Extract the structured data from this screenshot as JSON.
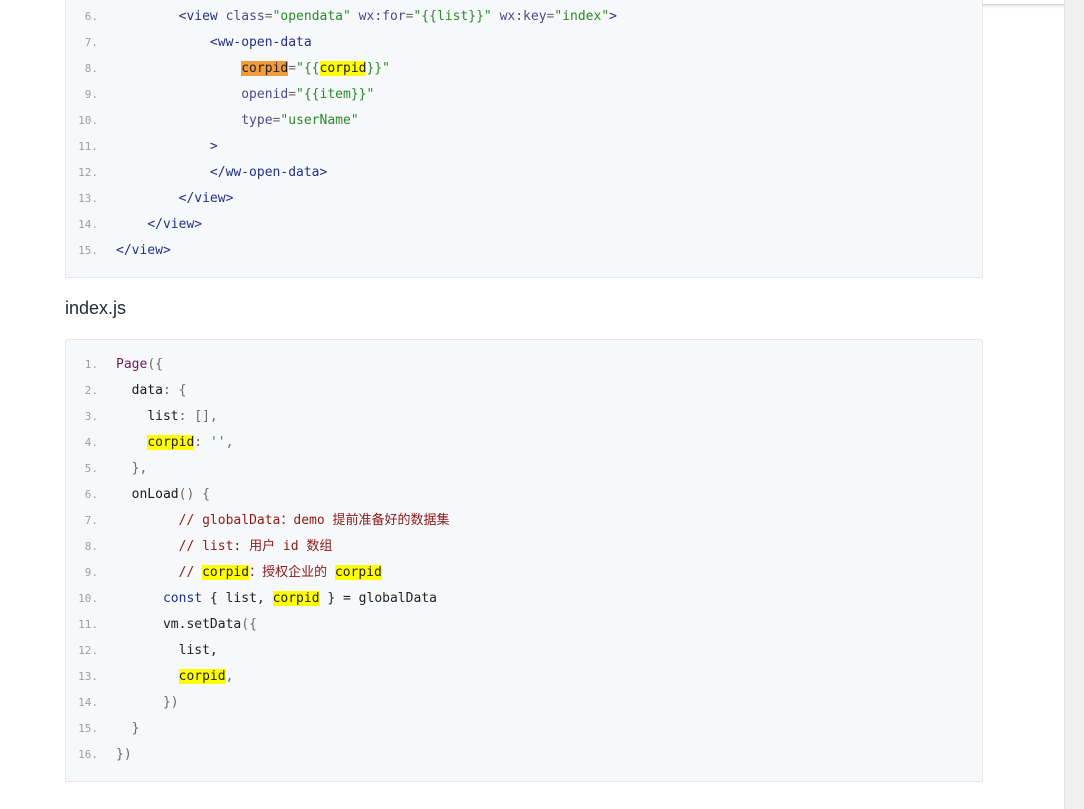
{
  "wxml_block": {
    "lines": [
      {
        "n": "6.",
        "tokens": [
          {
            "t": "        ",
            "c": "t-plain"
          },
          {
            "t": "<view ",
            "c": "t-tag"
          },
          {
            "t": "class",
            "c": "t-attr"
          },
          {
            "t": "=",
            "c": "t-punc"
          },
          {
            "t": "\"opendata\"",
            "c": "t-str"
          },
          {
            "t": " ",
            "c": "t-plain"
          },
          {
            "t": "wx:for",
            "c": "t-attr"
          },
          {
            "t": "=",
            "c": "t-punc"
          },
          {
            "t": "\"{{list}}\"",
            "c": "t-str"
          },
          {
            "t": " ",
            "c": "t-plain"
          },
          {
            "t": "wx:key",
            "c": "t-attr"
          },
          {
            "t": "=",
            "c": "t-punc"
          },
          {
            "t": "\"index\"",
            "c": "t-str"
          },
          {
            "t": ">",
            "c": "t-tag"
          }
        ]
      },
      {
        "n": "7.",
        "tokens": [
          {
            "t": "            ",
            "c": "t-plain"
          },
          {
            "t": "<ww-open-data",
            "c": "t-tag"
          }
        ]
      },
      {
        "n": "8.",
        "tokens": [
          {
            "t": "                ",
            "c": "t-plain"
          },
          {
            "t": "corpid",
            "c": "hl-cur"
          },
          {
            "t": "=",
            "c": "t-punc"
          },
          {
            "t": "\"{{",
            "c": "t-str"
          },
          {
            "t": "corpid",
            "c": "hl"
          },
          {
            "t": "}}\"",
            "c": "t-str"
          }
        ]
      },
      {
        "n": "9.",
        "tokens": [
          {
            "t": "                ",
            "c": "t-plain"
          },
          {
            "t": "openid",
            "c": "t-attr"
          },
          {
            "t": "=",
            "c": "t-punc"
          },
          {
            "t": "\"{{item}}\"",
            "c": "t-str"
          }
        ]
      },
      {
        "n": "10.",
        "tokens": [
          {
            "t": "                ",
            "c": "t-plain"
          },
          {
            "t": "type",
            "c": "t-attr"
          },
          {
            "t": "=",
            "c": "t-punc"
          },
          {
            "t": "\"userName\"",
            "c": "t-str"
          }
        ]
      },
      {
        "n": "11.",
        "tokens": [
          {
            "t": "            ",
            "c": "t-plain"
          },
          {
            "t": ">",
            "c": "t-tag"
          }
        ]
      },
      {
        "n": "12.",
        "tokens": [
          {
            "t": "            ",
            "c": "t-plain"
          },
          {
            "t": "</ww-open-data>",
            "c": "t-tag"
          }
        ]
      },
      {
        "n": "13.",
        "tokens": [
          {
            "t": "        ",
            "c": "t-plain"
          },
          {
            "t": "</view>",
            "c": "t-tag"
          }
        ]
      },
      {
        "n": "14.",
        "tokens": [
          {
            "t": "    ",
            "c": "t-plain"
          },
          {
            "t": "</view>",
            "c": "t-tag"
          }
        ]
      },
      {
        "n": "15.",
        "tokens": [
          {
            "t": "</view>",
            "c": "t-tag"
          }
        ]
      }
    ]
  },
  "file_title": "index.js",
  "js_block": {
    "lines": [
      {
        "n": "1.",
        "tokens": [
          {
            "t": "Page",
            "c": "t-key"
          },
          {
            "t": "({",
            "c": "t-punc"
          }
        ]
      },
      {
        "n": "2.",
        "tokens": [
          {
            "t": "  ",
            "c": "t-plain"
          },
          {
            "t": "data",
            "c": "t-prop"
          },
          {
            "t": ": {",
            "c": "t-punc"
          }
        ]
      },
      {
        "n": "3.",
        "tokens": [
          {
            "t": "    ",
            "c": "t-plain"
          },
          {
            "t": "list",
            "c": "t-prop"
          },
          {
            "t": ": [],",
            "c": "t-punc"
          }
        ]
      },
      {
        "n": "4.",
        "tokens": [
          {
            "t": "    ",
            "c": "t-plain"
          },
          {
            "t": "corpid",
            "c": "hl"
          },
          {
            "t": ": ",
            "c": "t-punc"
          },
          {
            "t": "''",
            "c": "t-str"
          },
          {
            "t": ",",
            "c": "t-punc"
          }
        ]
      },
      {
        "n": "5.",
        "tokens": [
          {
            "t": "  ",
            "c": "t-plain"
          },
          {
            "t": "},",
            "c": "t-punc"
          }
        ]
      },
      {
        "n": "6.",
        "tokens": [
          {
            "t": "  ",
            "c": "t-plain"
          },
          {
            "t": "onLoad",
            "c": "t-prop"
          },
          {
            "t": "() {",
            "c": "t-punc"
          }
        ]
      },
      {
        "n": "7.",
        "tokens": [
          {
            "t": "        ",
            "c": "t-plain"
          },
          {
            "t": "// globalData：demo 提前准备好的数据集",
            "c": "t-cm"
          }
        ]
      },
      {
        "n": "8.",
        "tokens": [
          {
            "t": "        ",
            "c": "t-plain"
          },
          {
            "t": "// list: 用户 id 数组",
            "c": "t-cm"
          }
        ]
      },
      {
        "n": "9.",
        "tokens": [
          {
            "t": "        ",
            "c": "t-plain"
          },
          {
            "t": "// ",
            "c": "t-cm"
          },
          {
            "t": "corpid",
            "c": "hl"
          },
          {
            "t": "：授权企业的 ",
            "c": "t-cm"
          },
          {
            "t": "corpid",
            "c": "hl"
          }
        ]
      },
      {
        "n": "10.",
        "tokens": [
          {
            "t": "      ",
            "c": "t-plain"
          },
          {
            "t": "const",
            "c": "t-tag"
          },
          {
            "t": " { list, ",
            "c": "t-plain"
          },
          {
            "t": "corpid",
            "c": "hl"
          },
          {
            "t": " } = globalData",
            "c": "t-plain"
          }
        ]
      },
      {
        "n": "11.",
        "tokens": [
          {
            "t": "      ",
            "c": "t-plain"
          },
          {
            "t": "vm.setData",
            "c": "t-fn"
          },
          {
            "t": "({",
            "c": "t-punc"
          }
        ]
      },
      {
        "n": "12.",
        "tokens": [
          {
            "t": "        ",
            "c": "t-plain"
          },
          {
            "t": "list,",
            "c": "t-plain"
          }
        ]
      },
      {
        "n": "13.",
        "tokens": [
          {
            "t": "        ",
            "c": "t-plain"
          },
          {
            "t": "corpid",
            "c": "hl"
          },
          {
            "t": ",",
            "c": "t-punc"
          }
        ]
      },
      {
        "n": "14.",
        "tokens": [
          {
            "t": "      ",
            "c": "t-plain"
          },
          {
            "t": "})",
            "c": "t-punc"
          }
        ]
      },
      {
        "n": "15.",
        "tokens": [
          {
            "t": "  ",
            "c": "t-plain"
          },
          {
            "t": "}",
            "c": "t-punc"
          }
        ]
      },
      {
        "n": "16.",
        "tokens": [
          {
            "t": "})",
            "c": "t-punc"
          }
        ]
      }
    ]
  }
}
